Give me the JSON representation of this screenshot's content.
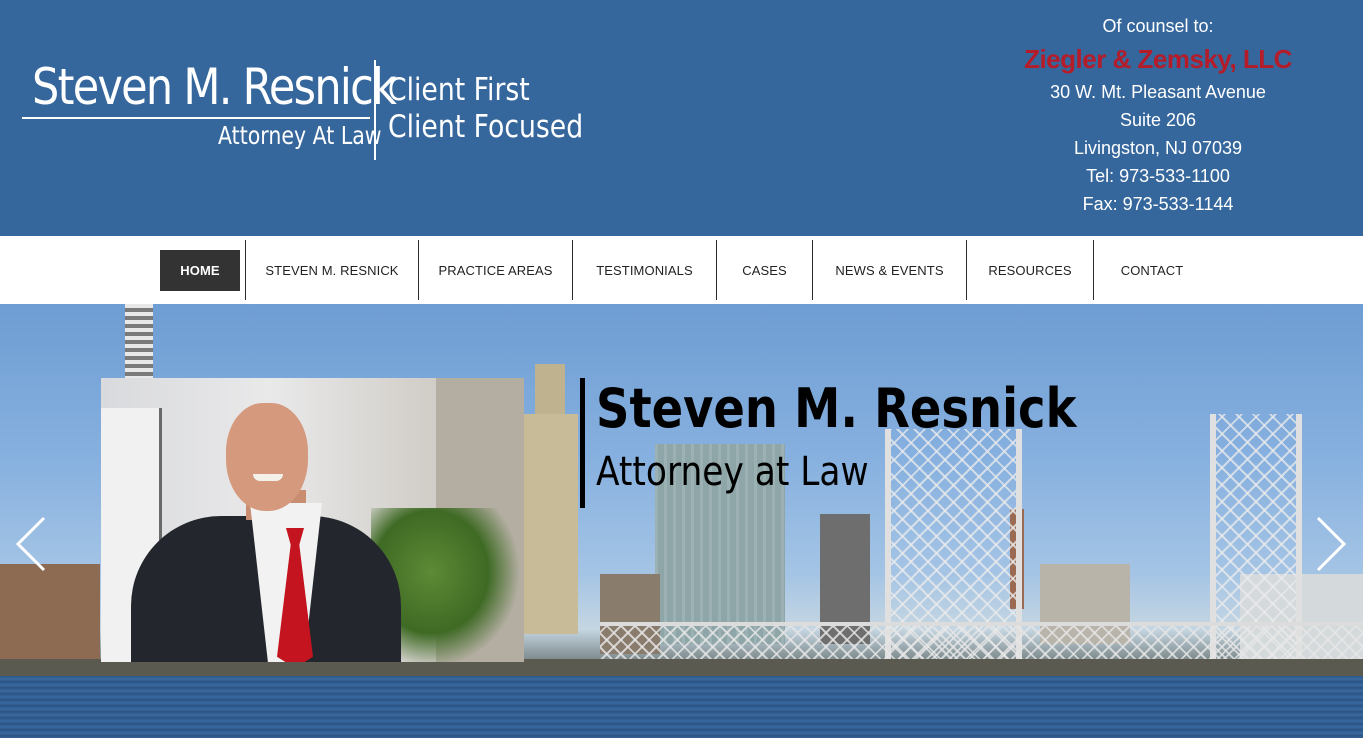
{
  "header": {
    "logo": {
      "name": "Steven M. Resnick",
      "subtitle": "Attorney At Law",
      "tagline_1": "Client First",
      "tagline_2": "Client Focused"
    },
    "counsel": {
      "label": "Of counsel to:",
      "firm": "Ziegler & Zemsky, LLC",
      "address_1": "30 W. Mt. Pleasant Avenue",
      "address_2": "Suite 206",
      "city": "Livingston, NJ 07039",
      "tel": "Tel: 973-533-1100",
      "fax": "Fax: 973-533-1144"
    },
    "colors": {
      "background": "#35679c",
      "firm": "#b51c2a"
    }
  },
  "nav": {
    "items": [
      {
        "label": "HOME",
        "active": true
      },
      {
        "label": "STEVEN M. RESNICK"
      },
      {
        "label": "PRACTICE AREAS"
      },
      {
        "label": "TESTIMONIALS"
      },
      {
        "label": "CASES"
      },
      {
        "label": "NEWS & EVENTS"
      },
      {
        "label": "RESOURCES"
      },
      {
        "label": "CONTACT"
      }
    ]
  },
  "hero": {
    "title": "Steven M. Resnick",
    "subtitle": "Attorney at Law",
    "prev_icon": "chevron-left-icon",
    "next_icon": "chevron-right-icon"
  }
}
